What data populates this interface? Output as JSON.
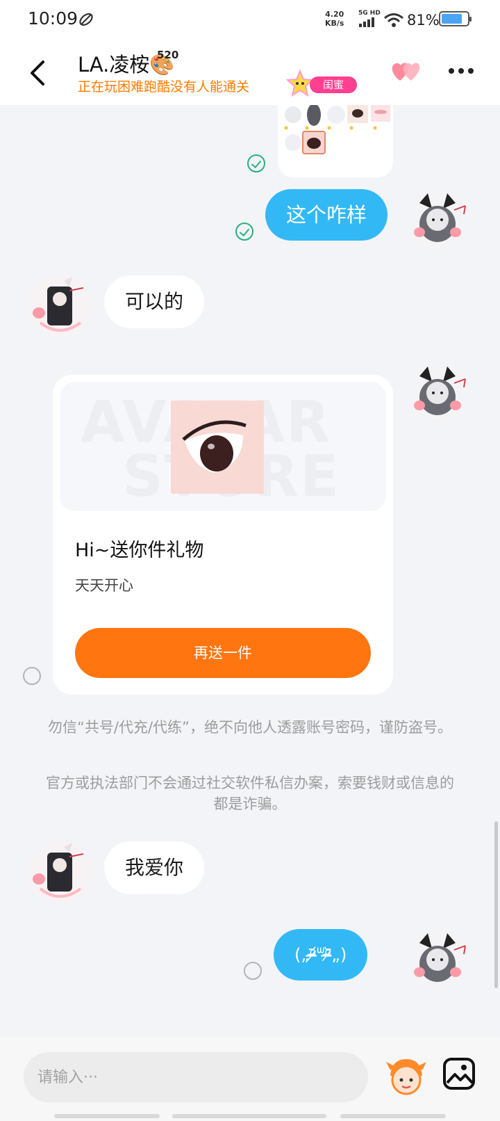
{
  "status_bar": {
    "time": "10:09",
    "net_speed": "4.20",
    "net_unit": "KB/s",
    "net_type": "5G HD",
    "battery_pct": "81%",
    "battery_level": 0.81
  },
  "header": {
    "name": "LA.凌桉🎨",
    "name_badge": "520",
    "status": "正在玩困难跑酷没有人能通关",
    "relation_badge": "闺蜜"
  },
  "messages": {
    "sent_1": "这个咋样",
    "received_1": "可以的",
    "received_2": "我爱你",
    "sent_2": "(„ᵒ̴̶̷᷄ᐜᵒ̴̶̷᷅„)"
  },
  "gift_card": {
    "watermark_line1": "AVATAR",
    "watermark_line2": "STORE",
    "title": "Hi~送你件礼物",
    "desc": "天天开心",
    "button": "再送一件"
  },
  "notices": {
    "notice_1": "勿信“共号/代充/代练”，绝不向他人透露账号密码，谨防盗号。",
    "notice_2": "官方或执法部门不会通过社交软件私信办案，索要钱财或信息的都是诈骗。"
  },
  "input": {
    "placeholder": "请输入···"
  },
  "colors": {
    "accent_orange": "#ff7510",
    "bubble_blue": "#33b8f6",
    "status_orange": "#ff7a00",
    "check_green": "#2ab07a"
  }
}
